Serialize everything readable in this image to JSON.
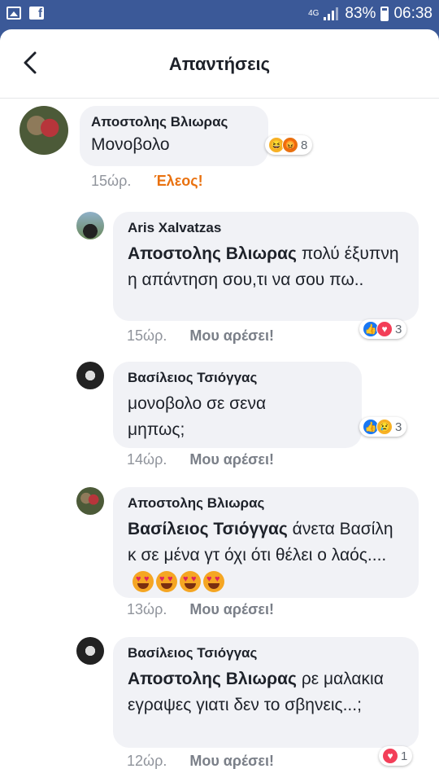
{
  "status_bar": {
    "network": "4G",
    "battery": "83%",
    "time": "06:38"
  },
  "header": {
    "title": "Απαντήσεις"
  },
  "comments": [
    {
      "name": "Αποστολης Βλιωρας",
      "mention": "",
      "text": "Μονοβολο",
      "time": "15ώρ.",
      "action": "Έλεος!",
      "reactions": [
        "haha",
        "angry"
      ],
      "reaction_count": "8"
    },
    {
      "name": "Aris Xalvatzas",
      "mention": "Αποστολης Βλιωρας",
      "text": "πολύ έξυπνη η απάντηση σου,τι να σου πω..",
      "time": "15ώρ.",
      "action": "Μου αρέσει!",
      "reactions": [
        "like",
        "love"
      ],
      "reaction_count": "3"
    },
    {
      "name": "Βασίλειος Τσιόγγας",
      "mention": "",
      "text": "μονοβολο σε σενα μηπως;",
      "time": "14ώρ.",
      "action": "Μου αρέσει!",
      "reactions": [
        "like",
        "sad"
      ],
      "reaction_count": "3"
    },
    {
      "name": "Αποστολης Βλιωρας",
      "mention": "Βασίλειος Τσιόγγας",
      "text": "άνετα Βασίλη κ σε μένα γτ όχι ότι θέλει ο λαός....",
      "time": "13ώρ.",
      "action": "Μου αρέσει!",
      "emojis": [
        "heart-eyes",
        "heart-eyes",
        "heart-eyes",
        "heart-eyes"
      ]
    },
    {
      "name": "Βασίλειος Τσιόγγας",
      "mention": "Αποστολης Βλιωρας",
      "text": "ρε μαλακια εγραψες γιατι δεν το σβηνεις...;",
      "time": "12ώρ.",
      "action": "Μου αρέσει!",
      "reactions": [
        "love"
      ],
      "reaction_count": "1"
    }
  ],
  "colors": {
    "facebook_blue": "#3b5998",
    "angry_orange": "#e9710f",
    "bubble_gray": "#f1f2f6"
  }
}
